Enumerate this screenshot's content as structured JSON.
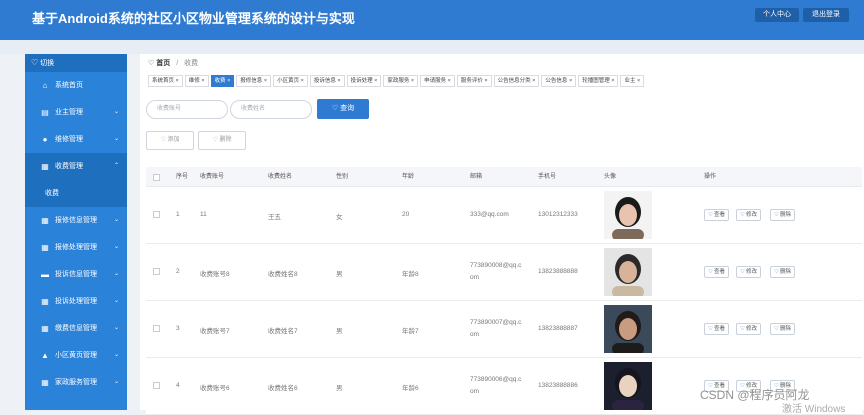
{
  "header": {
    "title": "基于Android系统的社区小区物业管理系统的设计与实现",
    "profile_btn": "个人中心",
    "logout_btn": "退出登录"
  },
  "sidebar": {
    "toggle_label": "切换",
    "items": [
      {
        "label": "系统首页",
        "icon": "home-icon",
        "glyph": "⌂",
        "chevron": false
      },
      {
        "label": "业主管理",
        "icon": "clipboard-icon",
        "glyph": "▤",
        "chevron": true
      },
      {
        "label": "维修管理",
        "icon": "user-icon",
        "glyph": "●",
        "chevron": true
      },
      {
        "label": "收费管理",
        "icon": "grid-icon",
        "glyph": "▦",
        "chevron": true,
        "active": true
      },
      {
        "label": "报修信息管理",
        "icon": "grid-icon",
        "glyph": "▦",
        "chevron": true
      },
      {
        "label": "报修处理管理",
        "icon": "grid-icon",
        "glyph": "▦",
        "chevron": true
      },
      {
        "label": "投诉信息管理",
        "icon": "monitor-icon",
        "glyph": "▬",
        "chevron": true
      },
      {
        "label": "投诉处理管理",
        "icon": "grid-icon",
        "glyph": "▦",
        "chevron": true
      },
      {
        "label": "缴费信息管理",
        "icon": "grid-icon",
        "glyph": "▦",
        "chevron": true
      },
      {
        "label": "小区黄页管理",
        "icon": "bank-icon",
        "glyph": "▲",
        "chevron": true
      },
      {
        "label": "家政服务管理",
        "icon": "grid-icon",
        "glyph": "▦",
        "chevron": true
      }
    ],
    "submenu_label": "收费"
  },
  "breadcrumb": {
    "home": "首页",
    "current": "收费"
  },
  "tabs": [
    "系统首页",
    "维修",
    "收费",
    "报修信息",
    "小区黄页",
    "投诉信息",
    "投诉处理",
    "家政服务",
    "申请服务",
    "服务评价",
    "公告信息分类",
    "公告信息",
    "轮播图管理",
    "业主"
  ],
  "active_tab": 2,
  "search": {
    "account_placeholder": "收费账号",
    "name_placeholder": "收费姓名",
    "button": "查询"
  },
  "actions": {
    "add": "添加",
    "delete": "删除"
  },
  "table": {
    "columns": [
      "序号",
      "收费账号",
      "收费姓名",
      "性别",
      "年龄",
      "邮箱",
      "手机号",
      "头像",
      "操作"
    ],
    "rows": [
      {
        "no": "1",
        "account": "11",
        "name": "王五",
        "gender": "女",
        "age": "20",
        "email": [
          "333@qq.com",
          ""
        ],
        "phone": "13012312333",
        "avatar": "woman-photo"
      },
      {
        "no": "2",
        "account": "收费账号8",
        "name": "收费姓名8",
        "gender": "男",
        "age": "年龄8",
        "email": [
          "773890008@qq.c",
          "om"
        ],
        "phone": "13823888888",
        "avatar": "man-glasses-photo"
      },
      {
        "no": "3",
        "account": "收费账号7",
        "name": "收费姓名7",
        "gender": "男",
        "age": "年龄7",
        "email": [
          "773890007@qq.c",
          "om"
        ],
        "phone": "13823888887",
        "avatar": "man-photo"
      },
      {
        "no": "4",
        "account": "收费账号6",
        "name": "收费姓名6",
        "gender": "男",
        "age": "年龄6",
        "email": [
          "773890006@qq.c",
          "om"
        ],
        "phone": "13823888886",
        "avatar": "anime-photo"
      }
    ],
    "row_actions": {
      "view": "查看",
      "edit": "修改",
      "delete": "删除"
    }
  },
  "watermark": {
    "text": "CSDN @程序员阿龙",
    "sub": "激活 Windows"
  }
}
